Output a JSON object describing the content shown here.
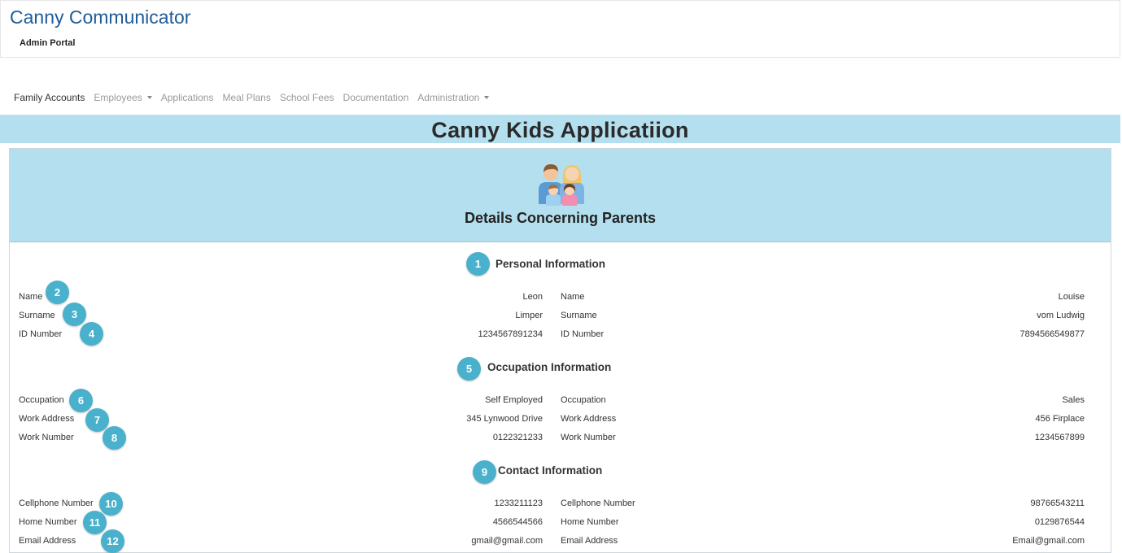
{
  "app": {
    "title": "Canny Communicator",
    "subtitle": "Admin Portal"
  },
  "nav": {
    "items": [
      {
        "label": "Family Accounts",
        "active": true
      },
      {
        "label": "Employees",
        "dropdown": true
      },
      {
        "label": "Applications"
      },
      {
        "label": "Meal Plans"
      },
      {
        "label": "School Fees"
      },
      {
        "label": "Documentation"
      },
      {
        "label": "Administration",
        "dropdown": true
      }
    ]
  },
  "banner": {
    "title": "Canny Kids Applicatiion"
  },
  "card": {
    "title": "Details Concerning Parents",
    "icon": "family-icon"
  },
  "sections": [
    {
      "title": "Personal Information",
      "badge": "1",
      "rows": [
        {
          "badge": "2",
          "label_left": "Name",
          "value_left": "Leon",
          "label_right": "Name",
          "value_right": "Louise"
        },
        {
          "badge": "3",
          "label_left": "Surname",
          "value_left": "Limper",
          "label_right": "Surname",
          "value_right": "vom Ludwig"
        },
        {
          "badge": "4",
          "label_left": "ID Number",
          "value_left": "1234567891234",
          "label_right": "ID Number",
          "value_right": "7894566549877"
        }
      ]
    },
    {
      "title": "Occupation Information",
      "badge": "5",
      "rows": [
        {
          "badge": "6",
          "label_left": "Occupation",
          "value_left": "Self Employed",
          "label_right": "Occupation",
          "value_right": "Sales"
        },
        {
          "badge": "7",
          "label_left": "Work Address",
          "value_left": "345 Lynwood Drive",
          "label_right": "Work Address",
          "value_right": "456 Firplace"
        },
        {
          "badge": "8",
          "label_left": "Work Number",
          "value_left": "0122321233",
          "label_right": "Work Number",
          "value_right": "1234567899"
        }
      ]
    },
    {
      "title": "Contact Information",
      "badge": "9",
      "rows": [
        {
          "badge": "10",
          "label_left": "Cellphone Number",
          "value_left": "1233211123",
          "label_right": "Cellphone Number",
          "value_right": "98766543211"
        },
        {
          "badge": "11",
          "label_left": "Home Number",
          "value_left": "4566544566",
          "label_right": "Home Number",
          "value_right": "0129876544"
        },
        {
          "badge": "12",
          "label_left": "Email Address",
          "value_left": "gmail@gmail.com",
          "label_right": "Email Address",
          "value_right": "Email@gmail.com"
        }
      ]
    }
  ],
  "colors": {
    "brand": "#1f5c99",
    "banner": "#b3dfee",
    "badge": "#4ab1cc"
  }
}
